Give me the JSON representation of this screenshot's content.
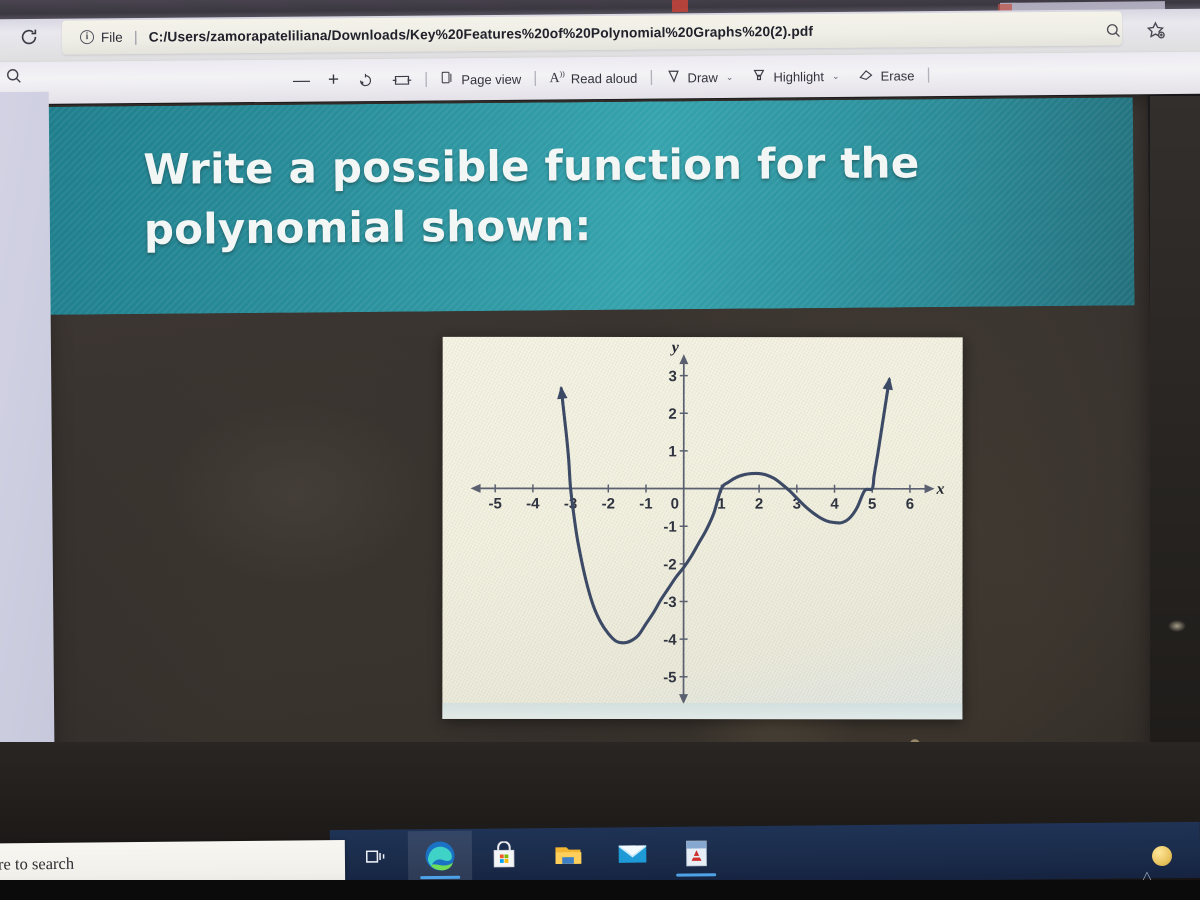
{
  "browser": {
    "reload_icon": "reload-icon",
    "security_label": "File",
    "info_icon": "info-circle-icon",
    "separator": "|",
    "url": "C:/Users/zamorapateliliana/Downloads/Key%20Features%20of%20Polynomial%20Graphs%20(2).pdf",
    "right_icons": [
      {
        "name": "search-icon",
        "glyph": "search"
      },
      {
        "name": "add-to-favorites-icon",
        "glyph": "star-plus"
      }
    ]
  },
  "pdf_toolbar": {
    "search_icon": "search-icon",
    "zoom_out_label": "—",
    "zoom_in_label": "+",
    "rotate_icon": "rotate-icon",
    "fit_width_icon": "fit-to-width-icon",
    "divider": "|",
    "items": [
      {
        "label": "Page view",
        "icon": "page-view-icon",
        "chevron": ""
      },
      {
        "label": "Read aloud",
        "icon": "read-aloud-icon",
        "chevron": ""
      },
      {
        "label": "Draw",
        "icon": "draw-pen-icon",
        "chevron": "⌄"
      },
      {
        "label": "Highlight",
        "icon": "highlighter-icon",
        "chevron": "⌄"
      },
      {
        "label": "Erase",
        "icon": "eraser-icon",
        "chevron": ""
      }
    ]
  },
  "document": {
    "banner_color": "#2b8f9b",
    "heading": "Write a possible function for the polynomial shown:"
  },
  "chart_data": {
    "type": "line",
    "title": "",
    "xlabel": "x",
    "ylabel": "y",
    "xlim": [
      -5.6,
      6.6
    ],
    "ylim": [
      -5.7,
      3.6
    ],
    "grid": false,
    "legend": null,
    "x_ticks": [
      -5,
      -4,
      -3,
      -2,
      -1,
      0,
      1,
      2,
      3,
      4,
      5,
      6
    ],
    "x_tick_labels": [
      "-5",
      "-4",
      "-3",
      "-2",
      "-1",
      "0",
      "1",
      "2",
      "3",
      "4",
      "5",
      "6"
    ],
    "y_ticks": [
      -5,
      -4,
      -3,
      -2,
      -1,
      1,
      2,
      3
    ],
    "y_tick_labels": [
      "-5",
      "-4",
      "-3",
      "-2",
      "-1",
      "1",
      "2",
      "3"
    ],
    "curve_color": "#3d4a66",
    "axis_color": "#5a6070",
    "roots": [
      -3,
      1,
      2,
      5
    ],
    "double_roots": [
      2
    ],
    "y_intercept": -2.1,
    "local_minima": [
      [
        -1.6,
        -4.1
      ],
      [
        4.2,
        -0.9
      ]
    ],
    "local_maxima": [
      [
        2,
        0
      ]
    ],
    "end_behavior": {
      "left": "up",
      "right": "up"
    },
    "degree": 4,
    "points": [
      [
        -3.25,
        2.65
      ],
      [
        -3.2,
        2.2
      ],
      [
        -3.15,
        1.75
      ],
      [
        -3.1,
        1.3
      ],
      [
        -3.05,
        0.75
      ],
      [
        -3.0,
        0.0
      ],
      [
        -2.9,
        -0.8
      ],
      [
        -2.8,
        -1.45
      ],
      [
        -2.6,
        -2.4
      ],
      [
        -2.4,
        -3.1
      ],
      [
        -2.2,
        -3.55
      ],
      [
        -2.0,
        -3.85
      ],
      [
        -1.8,
        -4.05
      ],
      [
        -1.6,
        -4.1
      ],
      [
        -1.4,
        -4.05
      ],
      [
        -1.2,
        -3.9
      ],
      [
        -1.0,
        -3.6
      ],
      [
        -0.8,
        -3.3
      ],
      [
        -0.6,
        -2.95
      ],
      [
        -0.4,
        -2.65
      ],
      [
        -0.2,
        -2.35
      ],
      [
        0.0,
        -2.1
      ],
      [
        0.2,
        -1.8
      ],
      [
        0.4,
        -1.45
      ],
      [
        0.6,
        -1.1
      ],
      [
        0.8,
        -0.65
      ],
      [
        1.0,
        0.0
      ],
      [
        1.2,
        0.18
      ],
      [
        1.4,
        0.3
      ],
      [
        1.6,
        0.37
      ],
      [
        1.8,
        0.4
      ],
      [
        2.0,
        0.4
      ],
      [
        2.2,
        0.36
      ],
      [
        2.4,
        0.27
      ],
      [
        2.6,
        0.12
      ],
      [
        2.8,
        -0.05
      ],
      [
        3.0,
        -0.25
      ],
      [
        3.2,
        -0.45
      ],
      [
        3.4,
        -0.62
      ],
      [
        3.6,
        -0.76
      ],
      [
        3.8,
        -0.86
      ],
      [
        4.0,
        -0.9
      ],
      [
        4.2,
        -0.9
      ],
      [
        4.4,
        -0.78
      ],
      [
        4.6,
        -0.5
      ],
      [
        4.8,
        -0.05
      ],
      [
        5.0,
        0.0
      ],
      [
        5.05,
        0.35
      ],
      [
        5.15,
        0.95
      ],
      [
        5.25,
        1.6
      ],
      [
        5.35,
        2.25
      ],
      [
        5.45,
        2.9
      ]
    ]
  },
  "taskbar": {
    "items": [
      {
        "name": "task-view-button",
        "label": "Task view",
        "active": false
      },
      {
        "name": "edge-browser-button",
        "label": "Microsoft Edge",
        "active": true
      },
      {
        "name": "microsoft-store-button",
        "label": "Microsoft Store",
        "active": false
      },
      {
        "name": "file-explorer-button",
        "label": "File Explorer",
        "active": false
      },
      {
        "name": "mail-button",
        "label": "Mail",
        "active": false
      },
      {
        "name": "adobe-reader-button",
        "label": "Adobe Acrobat Reader",
        "active": true
      }
    ]
  },
  "search": {
    "visible_text": "re to search",
    "placeholder": "Type here to search"
  }
}
